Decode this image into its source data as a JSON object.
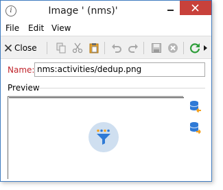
{
  "window": {
    "title": "Image ' (nms)'",
    "app_icon_glyph": "i"
  },
  "menu": {
    "file": "File",
    "edit": "Edit",
    "view": "View"
  },
  "toolbar": {
    "close_label": "Close",
    "icons": [
      "close-icon",
      "copy-icon",
      "cut-icon",
      "paste-icon",
      "undo-icon",
      "redo-icon",
      "save-icon",
      "cancel-icon",
      "refresh-icon",
      "overflow-arrow-icon"
    ]
  },
  "form": {
    "name_label": "Name:",
    "name_value": "nms:activities/dedup.png",
    "preview_label": "Preview"
  },
  "side_buttons": [
    "import-from-database-icon",
    "export-to-database-icon"
  ],
  "colors": {
    "close_button": "#c8413b",
    "name_label": "#c0242b",
    "preview_circle": "#cfdff0",
    "accent_blue": "#2f7ad6",
    "accent_orange": "#f3a221",
    "refresh_green": "#2e9e3a"
  }
}
